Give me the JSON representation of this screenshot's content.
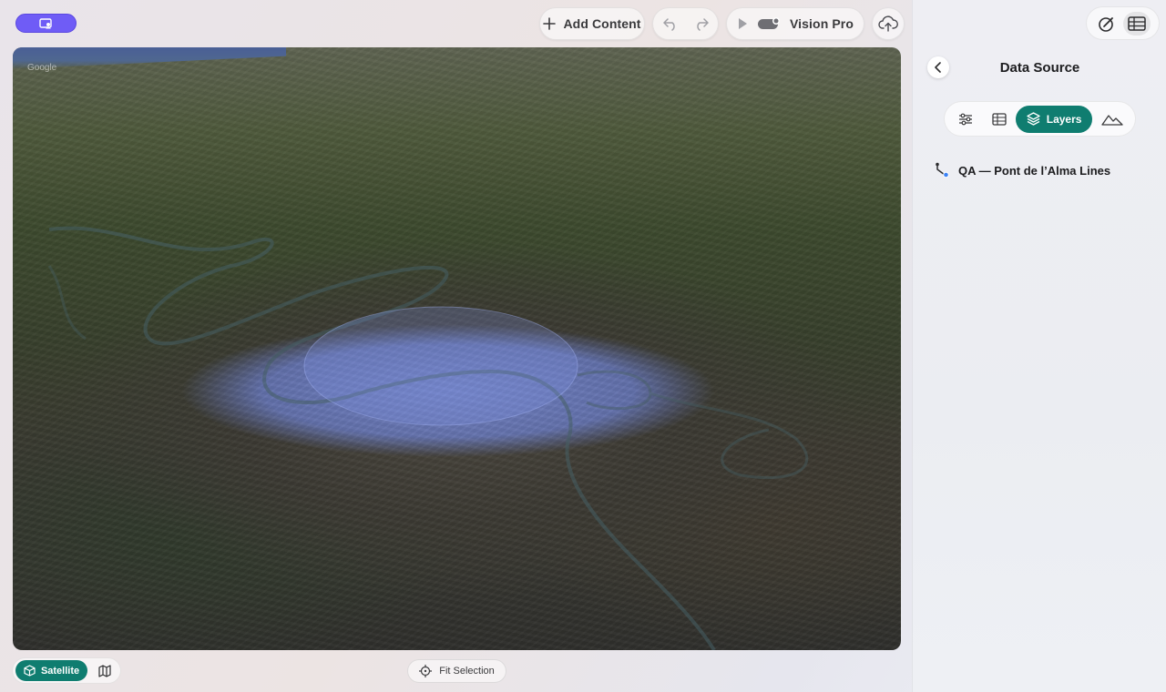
{
  "toolbar": {
    "add_content_label": "Add Content",
    "device_label": "Vision Pro"
  },
  "map": {
    "attribution": "Google"
  },
  "panel": {
    "title": "Data Source",
    "tabs": [
      {
        "icon": "sliders-icon"
      },
      {
        "icon": "table-icon"
      },
      {
        "icon": "layers-icon",
        "label": "Layers",
        "active": true
      },
      {
        "icon": "terrain-icon"
      }
    ],
    "layers": [
      {
        "name": "QA — Pont de l’Alma Lines",
        "icon": "line-layer-icon"
      }
    ]
  },
  "bottom": {
    "map_mode_active": "Satellite",
    "fit_selection_label": "Fit Selection"
  },
  "colors": {
    "accent": "#0f7d70",
    "badge": "#6f5cf6",
    "highlight_area": "#7f93e0"
  }
}
